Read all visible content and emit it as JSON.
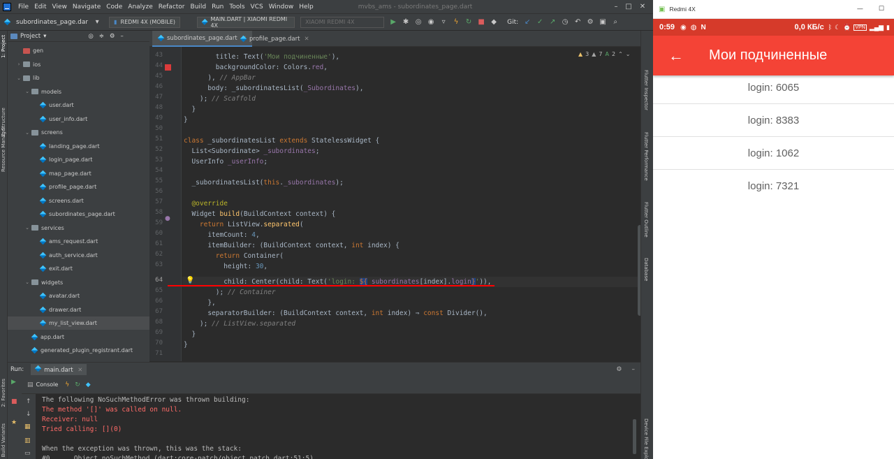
{
  "ide": {
    "menu": [
      "File",
      "Edit",
      "View",
      "Navigate",
      "Code",
      "Analyze",
      "Refactor",
      "Build",
      "Run",
      "Tools",
      "VCS",
      "Window",
      "Help"
    ],
    "window_title": "mvbs_ams - subordinates_page.dart",
    "toolbar": {
      "breadcrumb": "subordinates_page.dar",
      "device_combo": "REDMI 4X (MOBILE)",
      "config_combo": "MAIN.DART | XIAOMI REDMI 4X",
      "device2_combo": "XIAOMI REDMI 4X",
      "git_label": "Git:"
    },
    "project": {
      "header": "Project",
      "items": [
        {
          "label": "gen",
          "kind": "folder-red",
          "indent": 1,
          "arrow": ""
        },
        {
          "label": "ios",
          "kind": "folder",
          "indent": 1,
          "arrow": "›"
        },
        {
          "label": "lib",
          "kind": "folder",
          "indent": 1,
          "arrow": "⌄"
        },
        {
          "label": "models",
          "kind": "folder",
          "indent": 2,
          "arrow": "⌄"
        },
        {
          "label": "user.dart",
          "kind": "dart",
          "indent": 3,
          "arrow": ""
        },
        {
          "label": "user_info.dart",
          "kind": "dart",
          "indent": 3,
          "arrow": ""
        },
        {
          "label": "screens",
          "kind": "folder",
          "indent": 2,
          "arrow": "⌄"
        },
        {
          "label": "landing_page.dart",
          "kind": "dart",
          "indent": 3,
          "arrow": ""
        },
        {
          "label": "login_page.dart",
          "kind": "dart",
          "indent": 3,
          "arrow": ""
        },
        {
          "label": "map_page.dart",
          "kind": "dart",
          "indent": 3,
          "arrow": ""
        },
        {
          "label": "profile_page.dart",
          "kind": "dart",
          "indent": 3,
          "arrow": ""
        },
        {
          "label": "screens.dart",
          "kind": "dart",
          "indent": 3,
          "arrow": ""
        },
        {
          "label": "subordinates_page.dart",
          "kind": "dart",
          "indent": 3,
          "arrow": ""
        },
        {
          "label": "services",
          "kind": "folder",
          "indent": 2,
          "arrow": "⌄"
        },
        {
          "label": "ams_request.dart",
          "kind": "dart",
          "indent": 3,
          "arrow": ""
        },
        {
          "label": "auth_service.dart",
          "kind": "dart",
          "indent": 3,
          "arrow": ""
        },
        {
          "label": "exit.dart",
          "kind": "dart",
          "indent": 3,
          "arrow": ""
        },
        {
          "label": "widgets",
          "kind": "folder",
          "indent": 2,
          "arrow": "⌄"
        },
        {
          "label": "avatar.dart",
          "kind": "dart",
          "indent": 3,
          "arrow": ""
        },
        {
          "label": "drawer.dart",
          "kind": "dart",
          "indent": 3,
          "arrow": ""
        },
        {
          "label": "my_list_view.dart",
          "kind": "dart",
          "indent": 3,
          "arrow": "",
          "selected": true
        },
        {
          "label": "app.dart",
          "kind": "dart",
          "indent": 2,
          "arrow": ""
        },
        {
          "label": "generated_plugin_registrant.dart",
          "kind": "dart",
          "indent": 2,
          "arrow": ""
        }
      ]
    },
    "tabs": [
      {
        "label": "subordinates_page.dart",
        "active": true
      },
      {
        "label": "profile_page.dart",
        "active": false
      }
    ],
    "inspections": {
      "warnings": "3",
      "weak": "7",
      "typos": "2"
    },
    "left_tools": [
      "1: Project",
      "Z: Structure",
      "Resource Manager",
      "2: Favorites",
      "Build Variants"
    ],
    "right_tools": [
      "Flutter Inspector",
      "Flutter Performance",
      "Flutter Outline",
      "Database",
      "Device File Explorer"
    ],
    "line_numbers": [
      "43",
      "44",
      "45",
      "46",
      "47",
      "48",
      "49",
      "50",
      "51",
      "52",
      "53",
      "54",
      "55",
      "56",
      "57",
      "58",
      "59",
      "60",
      "61",
      "62",
      "63",
      "64",
      "65",
      "66",
      "67",
      "68",
      "69",
      "70",
      "71"
    ],
    "run": {
      "label": "Run:",
      "tab": "main.dart",
      "console_tab": "Console",
      "lines": [
        {
          "text": "The following NoSuchMethodError was thrown building:",
          "color": "#bbbbbb"
        },
        {
          "text": "The method '[]' was called on null.",
          "color": "#ff6b68"
        },
        {
          "text": "Receiver: null",
          "color": "#ff6b68"
        },
        {
          "text": "Tried calling: [](0)",
          "color": "#ff6b68"
        },
        {
          "text": "",
          "color": "#bbbbbb"
        },
        {
          "text": "When the exception was thrown, this was the stack:",
          "color": "#bbbbbb"
        },
        {
          "text": "#0      Object.noSuchMethod (dart:core-patch/object_patch.dart:51:5)",
          "color": "#bbbbbb"
        }
      ]
    }
  },
  "phone": {
    "window_title": "Redmi 4X",
    "status": {
      "time": "0:59",
      "speed": "0,0 КБ/с",
      "vpn": "VPN"
    },
    "appbar_title": "Мои подчиненные",
    "items": [
      "login: 6065",
      "login: 8383",
      "login: 1062",
      "login: 7321"
    ],
    "accent_color": "#f44336"
  }
}
